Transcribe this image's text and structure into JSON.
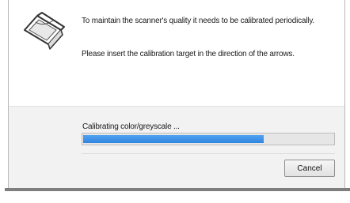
{
  "dialog": {
    "message_line1": "To maintain the scanner's quality it needs to be calibrated periodically.",
    "message_line2": "Please insert the calibration target in the direction of the arrows.",
    "status_text": "Calibrating color/greyscale ...",
    "progress": 0.72,
    "cancel_label": "Cancel",
    "icon": "scanner-icon",
    "colors": {
      "progress_fill": "#2f84e0",
      "pane_bottom": "#f2f2f2"
    }
  }
}
